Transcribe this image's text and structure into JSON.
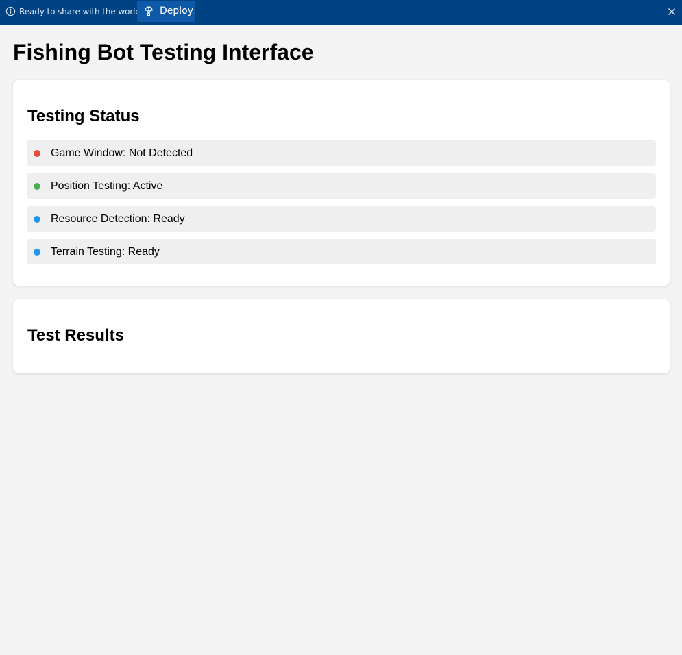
{
  "banner": {
    "message": "Ready to share with the world?",
    "deploy_label": "Deploy",
    "info_icon": "info-icon",
    "deploy_icon": "deploy-icon",
    "close_icon": "close-icon",
    "background_color": "#004385"
  },
  "page": {
    "title": "Fishing Bot Testing Interface"
  },
  "status_card": {
    "heading": "Testing Status",
    "items": [
      {
        "label": "Game Window: Not Detected",
        "state": "error",
        "color": "#e74c3c"
      },
      {
        "label": "Position Testing: Active",
        "state": "active",
        "color": "#4caf50"
      },
      {
        "label": "Resource Detection: Ready",
        "state": "ready",
        "color": "#2196f3"
      },
      {
        "label": "Terrain Testing: Ready",
        "state": "ready",
        "color": "#2196f3"
      }
    ]
  },
  "results_card": {
    "heading": "Test Results"
  }
}
